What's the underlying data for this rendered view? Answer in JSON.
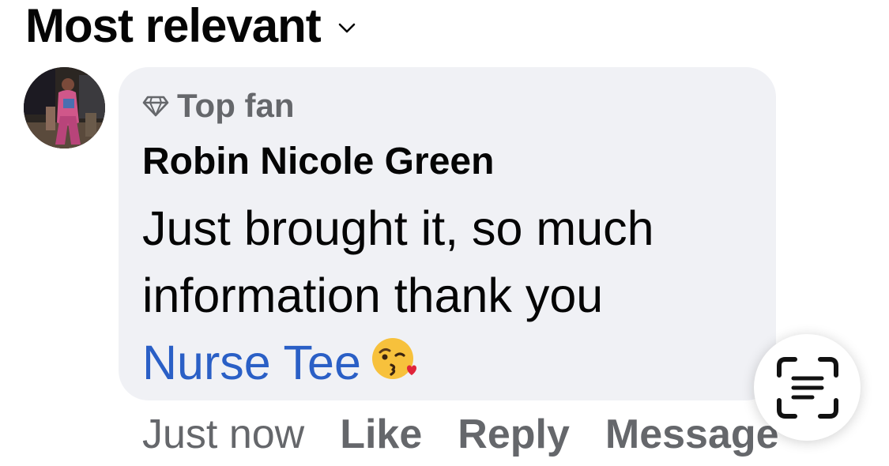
{
  "sort": {
    "label": "Most relevant",
    "icon": "chevron-down-icon"
  },
  "comment": {
    "badge": "Top fan",
    "badge_icon": "diamond-icon",
    "author": "Robin Nicole Green",
    "text": "Just brought it, so much information thank you",
    "mention": "Nurse Tee",
    "emoji": "😘",
    "timestamp": "Just now",
    "actions": {
      "like": "Like",
      "reply": "Reply",
      "message": "Message"
    }
  },
  "scan_button": {
    "icon": "live-text-scan-icon"
  },
  "colors": {
    "bubble": "#f0f1f5",
    "meta_gray": "#65676b",
    "mention_blue": "#2a5fc6"
  }
}
